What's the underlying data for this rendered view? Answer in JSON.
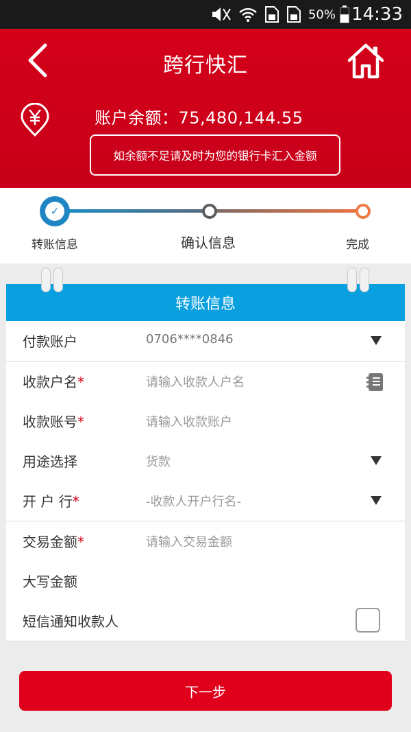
{
  "status_bar": {
    "battery_percent": "50%",
    "time": "14:33"
  },
  "header": {
    "title": "跨行快汇",
    "balance_text": "账户余额：75,480,144.55",
    "notice": "如余额不足请及时为您的银行卡汇入金额"
  },
  "steps": [
    {
      "label": "转账信息",
      "state": "done"
    },
    {
      "label": "确认信息",
      "state": "current"
    },
    {
      "label": "完成",
      "state": "pending"
    }
  ],
  "form": {
    "section_title": "转账信息",
    "payer_account": {
      "label": "付款账户",
      "value": "0706****0846"
    },
    "payee_name": {
      "label": "收款户名",
      "required": "*",
      "placeholder": "请输入收款人户名"
    },
    "payee_account": {
      "label": "收款账号",
      "required": "*",
      "placeholder": "请输入收款账户"
    },
    "purpose": {
      "label": "用途选择",
      "value": "货款"
    },
    "bank": {
      "label": "开 户 行",
      "required": "*",
      "placeholder": "-收款人开户行名-"
    },
    "amount": {
      "label": "交易金额",
      "required": "*",
      "placeholder": "请输入交易金额"
    },
    "amount_upper": {
      "label": "大写金额",
      "value": ""
    },
    "sms_notify": {
      "label": "短信通知收款人",
      "checked": false
    }
  },
  "next_button": "下一步",
  "colors": {
    "brand_red": "#d4001a",
    "section_blue": "#0aa0e0",
    "step_blue": "#1f86c4",
    "step_orange": "#ef7a45"
  }
}
